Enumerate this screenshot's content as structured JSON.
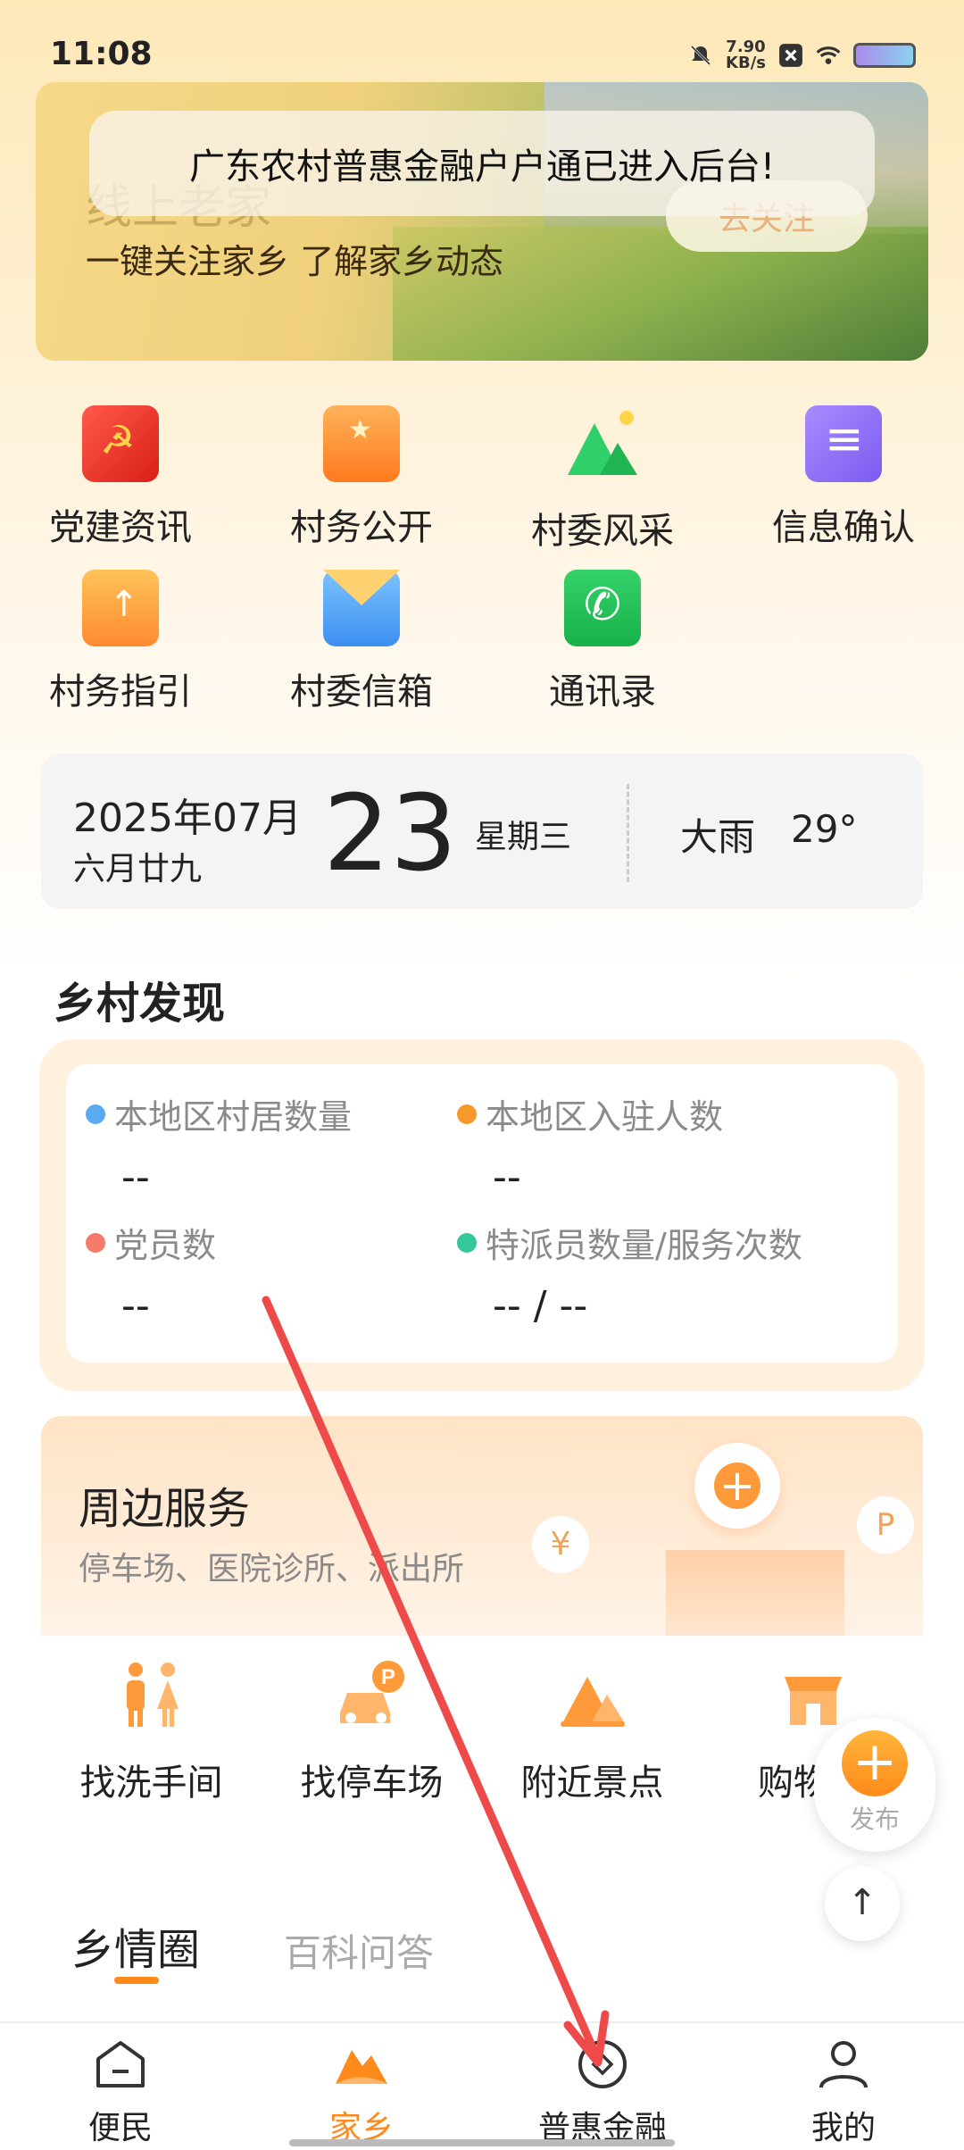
{
  "status_bar": {
    "time": "11:08",
    "net_speed_value": "7.90",
    "net_speed_unit": "KB/s",
    "icons": [
      "mute-bell-icon",
      "x-close-icon",
      "wifi-icon",
      "battery-icon"
    ]
  },
  "banner": {
    "title": "线上老家",
    "subtitle": "一键关注家乡 了解家乡动态",
    "follow_label": "去关注"
  },
  "toast": {
    "message": "广东农村普惠金融户户通已进入后台!"
  },
  "grid_menu": [
    {
      "label": "党建资讯",
      "icon": "party-flag-icon"
    },
    {
      "label": "村务公开",
      "icon": "village-affairs-icon"
    },
    {
      "label": "村委风采",
      "icon": "mountain-icon"
    },
    {
      "label": "信息确认",
      "icon": "document-icon"
    },
    {
      "label": "村务指引",
      "icon": "guide-icon"
    },
    {
      "label": "村委信箱",
      "icon": "mailbox-icon"
    },
    {
      "label": "通讯录",
      "icon": "phone-book-icon"
    }
  ],
  "date_card": {
    "year_month": "2025年07月",
    "lunar": "六月廿九",
    "day": "23",
    "weekday": "星期三",
    "weather": "大雨",
    "temperature": "29°"
  },
  "discover": {
    "title": "乡村发现",
    "stats": [
      {
        "label": "本地区村居数量",
        "value": "--",
        "dot_color": "#5aaaf0"
      },
      {
        "label": "本地区入驻人数",
        "value": "--",
        "dot_color": "#f59a2a"
      },
      {
        "label": "党员数",
        "value": "--",
        "dot_color": "#f47a6a"
      },
      {
        "label": "特派员数量/服务次数",
        "value": "-- / --",
        "dot_color": "#36c79a"
      }
    ]
  },
  "nearby": {
    "title": "周边服务",
    "subtitle": "停车场、医院诊所、派出所",
    "deco_yen": "¥",
    "deco_p": "P",
    "items": [
      {
        "label": "找洗手间",
        "icon": "restroom-icon"
      },
      {
        "label": "找停车场",
        "icon": "parking-car-icon"
      },
      {
        "label": "附近景点",
        "icon": "scenic-spot-icon"
      },
      {
        "label": "购物",
        "icon": "shop-icon"
      }
    ]
  },
  "fab": {
    "label": "发布"
  },
  "back_to_top": "↑",
  "feed_tabs": [
    {
      "label": "乡情圈",
      "active": true
    },
    {
      "label": "百科问答",
      "active": false
    }
  ],
  "bottom_nav": [
    {
      "label": "便民",
      "icon": "home-outline-icon",
      "active": false
    },
    {
      "label": "家乡",
      "icon": "hometown-mountain-icon",
      "active": true
    },
    {
      "label": "普惠金融",
      "icon": "finance-diamond-icon",
      "active": false
    },
    {
      "label": "我的",
      "icon": "person-icon",
      "active": false
    }
  ],
  "colors": {
    "accent": "#ff8a1c",
    "annotation_arrow": "#ee4a4a"
  }
}
